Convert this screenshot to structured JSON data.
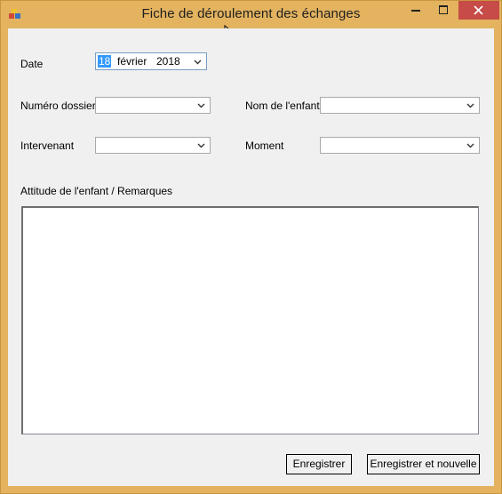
{
  "window": {
    "title": "Fiche de déroulement des échanges"
  },
  "form": {
    "date_label": "Date",
    "date": {
      "day": "18",
      "month": "février",
      "year": "2018"
    },
    "numero_dossier_label": "Numéro dossier",
    "nom_enfant_label": "Nom de l'enfant",
    "intervenant_label": "Intervenant",
    "moment_label": "Moment",
    "attitude_label": "Attitude de l'enfant / Remarques",
    "numero_dossier_value": "",
    "nom_enfant_value": "",
    "intervenant_value": "",
    "moment_value": "",
    "remarques_value": ""
  },
  "buttons": {
    "save": "Enregistrer",
    "save_new": "Enregistrer et nouvelle"
  },
  "colors": {
    "titlebar": "#e3b35f",
    "close": "#c74b47",
    "client_bg": "#f0f0f0"
  }
}
